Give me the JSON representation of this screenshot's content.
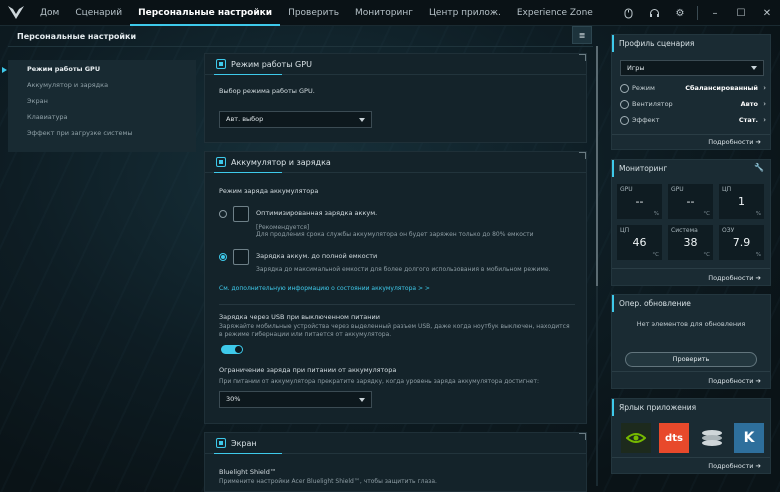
{
  "nav": {
    "tabs": [
      "Дом",
      "Сценарий",
      "Персональные настройки",
      "Проверить",
      "Мониторинг",
      "Центр прилож.",
      "Experience Zone"
    ],
    "active": 2
  },
  "page": {
    "title": "Персональные настройки"
  },
  "leftnav": {
    "items": [
      "Режим работы GPU",
      "Аккумулятор и зарядка",
      "Экран",
      "Клавиатура",
      "Эффект при загрузке системы"
    ]
  },
  "gpu": {
    "title": "Режим работы GPU",
    "label": "Выбор режима работы GPU.",
    "select": "Авт. выбор"
  },
  "battery": {
    "title": "Аккумулятор и зарядка",
    "mode_label": "Режим заряда аккумулятора",
    "opt1_title": "Оптимизированная зарядка аккум.",
    "opt1_rec": "[Рекомендуется]",
    "opt1_desc": "Для продления срока службы аккумулятора он будет заряжен только до 80% емкости",
    "opt2_title": "Зарядка аккум. до полной емкости",
    "opt2_desc": "Зарядка до максимальной емкости для более долгого использования в мобильном режиме.",
    "link": "См. дополнительную информацию о состоянии аккумулятора > >",
    "usb_title": "Зарядка через USB при выключенном питании",
    "usb_desc1": "Заряжайте мобильные устройства через выделенный разъем USB, даже когда ноутбук выключен, находится",
    "usb_desc2": "в режиме гибернации или питается от аккумулятора.",
    "limit_title": "Ограничение заряда при питании от аккумулятора",
    "limit_desc": "При питании от аккумулятора прекратите зарядку, когда уровень заряда аккумулятора достигнет:",
    "limit_select": "30%"
  },
  "screen": {
    "title": "Экран",
    "bluelight": "Bluelight Shield™",
    "bluelight_desc": "Примените настройки Acer Bluelight Shield™, чтобы защитить глаза."
  },
  "profile": {
    "title": "Профиль сценария",
    "select": "Игры",
    "rows": [
      {
        "label": "Режим",
        "value": "Сбалансированный"
      },
      {
        "label": "Вентилятор",
        "value": "Авто"
      },
      {
        "label": "Эффект",
        "value": "Стат."
      }
    ],
    "more": "Подробности"
  },
  "monitor": {
    "title": "Мониторинг",
    "more": "Подробности",
    "metrics": [
      {
        "label": "GPU",
        "value": "--",
        "unit": "%"
      },
      {
        "label": "GPU",
        "value": "--",
        "unit": "°C"
      },
      {
        "label": "ЦП",
        "value": "1",
        "unit": "%"
      },
      {
        "label": "ЦП",
        "value": "46",
        "unit": "°C"
      },
      {
        "label": "Система",
        "value": "38",
        "unit": "°C"
      },
      {
        "label": "ОЗУ",
        "value": "7.9",
        "unit": "%"
      }
    ]
  },
  "update": {
    "title": "Опер. обновление",
    "empty": "Нет элементов для обновления",
    "button": "Проверить",
    "more": "Подробности"
  },
  "shortcuts": {
    "title": "Ярлык приложения",
    "apps": [
      "NVIDIA",
      "dts",
      "",
      "K"
    ],
    "more": "Подробности"
  },
  "colors": {
    "accent": "#3ec9ea"
  }
}
